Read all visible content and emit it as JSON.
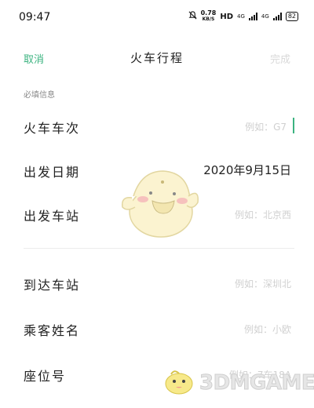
{
  "status_bar": {
    "time": "09:47",
    "net_speed": "0.78",
    "net_unit": "KB/S",
    "hd": "HD",
    "net_type_1": "4G",
    "net_type_2": "4G",
    "battery": "82"
  },
  "header": {
    "cancel_label": "取消",
    "title": "火车行程",
    "done_label": "完成"
  },
  "section_title": "必填信息",
  "fields": [
    {
      "label": "火车车次",
      "placeholder": "例如：G7"
    },
    {
      "label": "出发日期",
      "value": "2020年9月15日"
    },
    {
      "label": "出发车站",
      "placeholder": "例如：北京西"
    },
    {
      "label": "到达车站",
      "placeholder": "例如：深圳北"
    },
    {
      "label": "乘客姓名",
      "placeholder": "例如：小欧"
    },
    {
      "label": "座位号",
      "placeholder": "例如：7车18A"
    }
  ],
  "watermark": {
    "text": "3DMGAME"
  },
  "colors": {
    "accent": "#3cb380",
    "placeholder": "#d0d0d0",
    "text": "#222222"
  }
}
